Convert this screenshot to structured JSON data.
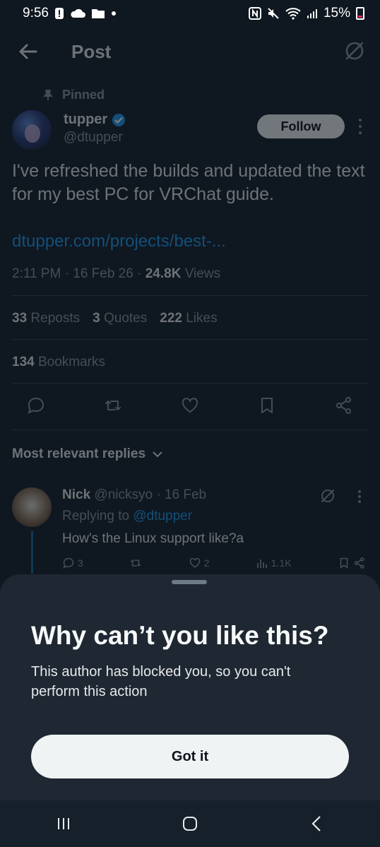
{
  "status": {
    "time": "9:56",
    "battery": "15%"
  },
  "header": {
    "title": "Post"
  },
  "post": {
    "pinned_label": "Pinned",
    "author_name": "tupper",
    "author_handle": "@dtupper",
    "follow_label": "Follow",
    "text": "I've refreshed the builds and updated the text for my best PC for VRChat guide.",
    "link": "dtupper.com/projects/best-...",
    "time": "2:11 PM",
    "date": "16 Feb 26",
    "views_count": "24.8K",
    "views_label": "Views",
    "reposts_count": "33",
    "reposts_label": "Reposts",
    "quotes_count": "3",
    "quotes_label": "Quotes",
    "likes_count": "222",
    "likes_label": "Likes",
    "bookmarks_count": "134",
    "bookmarks_label": "Bookmarks"
  },
  "replies": {
    "sort_label": "Most relevant replies",
    "items": [
      {
        "name": "Nick",
        "handle": "@nicksyo",
        "date": "16 Feb",
        "replying_prefix": "Replying to",
        "replying_to": "@dtupper",
        "text": "How's the Linux support like?a",
        "reply_count": "3",
        "like_count": "2",
        "view_count": "1.1K"
      }
    ]
  },
  "sheet": {
    "title": "Why can’t you like this?",
    "body": "This author has blocked you, so you can't perform this action",
    "button_label": "Got it"
  },
  "colors": {
    "background": "#15202b",
    "accent": "#1d9bf0",
    "sheet": "#1e2732"
  }
}
